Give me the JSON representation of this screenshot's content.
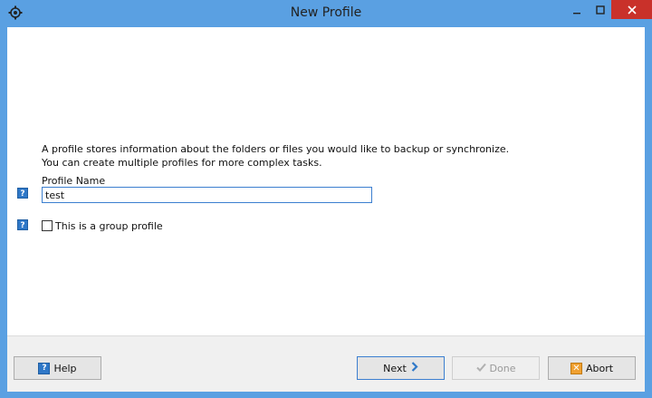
{
  "window": {
    "title": "New Profile"
  },
  "content": {
    "description_line1": "A profile stores information about the folders or files you would like to backup or synchronize.",
    "description_line2": "You can create multiple profiles for more complex tasks.",
    "profile_name_label": "Profile Name",
    "profile_name_value": "test",
    "group_profile_label": "This is a group profile",
    "group_profile_checked": false,
    "help_icon_glyph": "?"
  },
  "footer": {
    "help_label": "Help",
    "next_label": "Next",
    "done_label": "Done",
    "abort_label": "Abort",
    "abort_icon_glyph": "✕"
  },
  "colors": {
    "title_bar": "#5aa0e2",
    "close_button": "#c9312a",
    "help_icon": "#2f78c8",
    "focus_border": "#3c7fd0",
    "abort_icon": "#f0a030"
  },
  "icons": {
    "app": "gear-app-icon",
    "minimize": "minimize-icon",
    "maximize": "maximize-icon",
    "close": "close-icon",
    "help": "help-icon",
    "next": "chevron-right-icon",
    "done": "checkmark-icon",
    "abort": "abort-x-icon"
  }
}
